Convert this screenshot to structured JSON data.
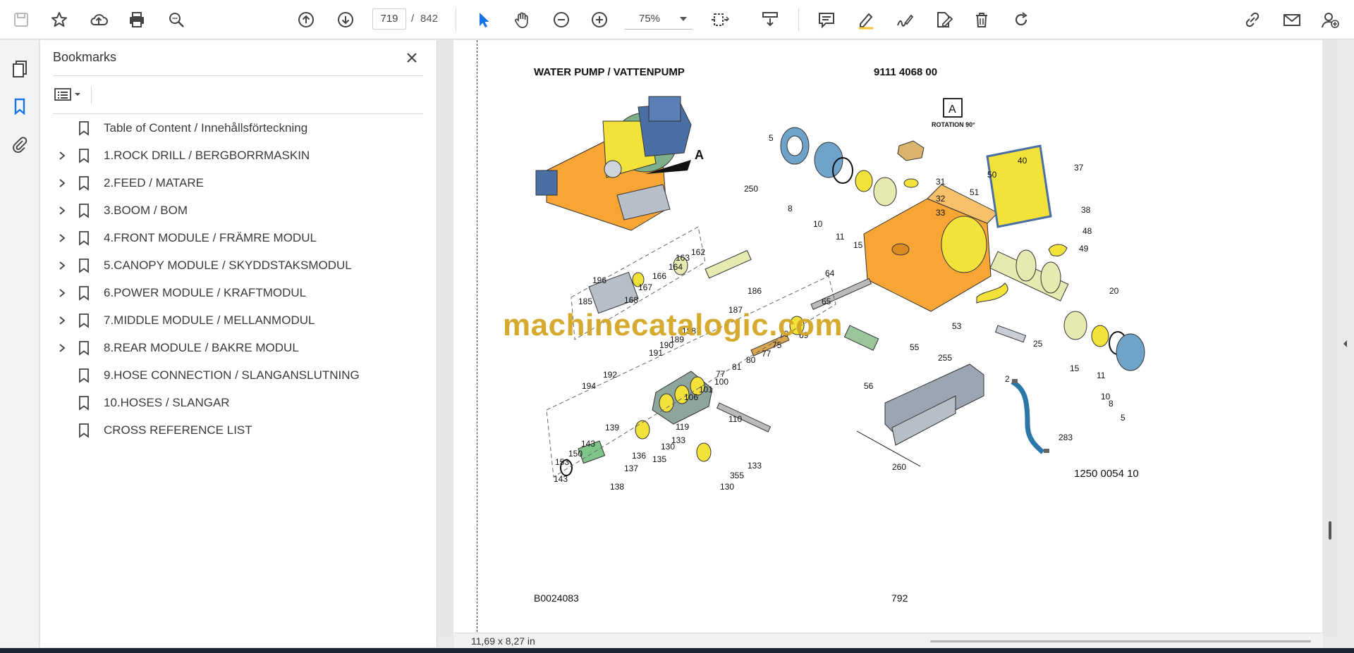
{
  "toolbar": {
    "current_page": "719",
    "page_separator": "/",
    "total_pages": "842",
    "zoom": "75%"
  },
  "bookmarks": {
    "title": "Bookmarks",
    "items": [
      {
        "label": "Table of Content / Innehållsförteckning",
        "expandable": false
      },
      {
        "label": "1.ROCK DRILL / BERGBORRMASKIN",
        "expandable": true
      },
      {
        "label": "2.FEED / MATARE",
        "expandable": true
      },
      {
        "label": "3.BOOM / BOM",
        "expandable": true
      },
      {
        "label": "4.FRONT MODULE / FRÄMRE MODUL",
        "expandable": true
      },
      {
        "label": "5.CANOPY MODULE / SKYDDSTAKSMODUL",
        "expandable": true
      },
      {
        "label": "6.POWER MODULE / KRAFTMODUL",
        "expandable": true
      },
      {
        "label": "7.MIDDLE MODULE / MELLANMODUL",
        "expandable": true
      },
      {
        "label": "8.REAR MODULE / BAKRE MODUL",
        "expandable": true
      },
      {
        "label": "9.HOSE CONNECTION / SLANGANSLUTNING",
        "expandable": false
      },
      {
        "label": "10.HOSES / SLANGAR",
        "expandable": false
      },
      {
        "label": "CROSS REFERENCE LIST",
        "expandable": false
      }
    ]
  },
  "document": {
    "title": "WATER PUMP / VATTENPUMP",
    "part_number": "9111 4068 00",
    "footer_code": "B0024083",
    "page_number": "792",
    "drawing_number": "1250 0054 10",
    "view_label": "A",
    "rotation_label": "ROTATION 90°",
    "watermark": "machinecatalogic.com",
    "callouts": [
      "5",
      "250",
      "8",
      "10",
      "11",
      "15",
      "31",
      "32",
      "33",
      "40",
      "50",
      "51",
      "37",
      "38",
      "48",
      "49",
      "64",
      "65",
      "53",
      "55",
      "56",
      "20",
      "25",
      "2",
      "255",
      "15",
      "11",
      "10",
      "8",
      "5",
      "283",
      "260",
      "196",
      "185",
      "168",
      "167",
      "166",
      "164",
      "163",
      "162",
      "187",
      "186",
      "188",
      "189",
      "190",
      "191",
      "192",
      "194",
      "75",
      "77",
      "80",
      "81",
      "77",
      "69",
      "70",
      "100",
      "101",
      "106",
      "110",
      "119",
      "133",
      "130",
      "135",
      "136",
      "137",
      "138",
      "139",
      "143",
      "150",
      "153",
      "143",
      "133",
      "355",
      "130"
    ]
  },
  "status": {
    "page_size": "11,69 x 8,27 in"
  },
  "colors": {
    "accent": "#1473e6",
    "pump_orange": "#f7a534",
    "motor_blue": "#4a6fa5",
    "yellow": "#f3e23a",
    "watermark": "#d4a623"
  }
}
